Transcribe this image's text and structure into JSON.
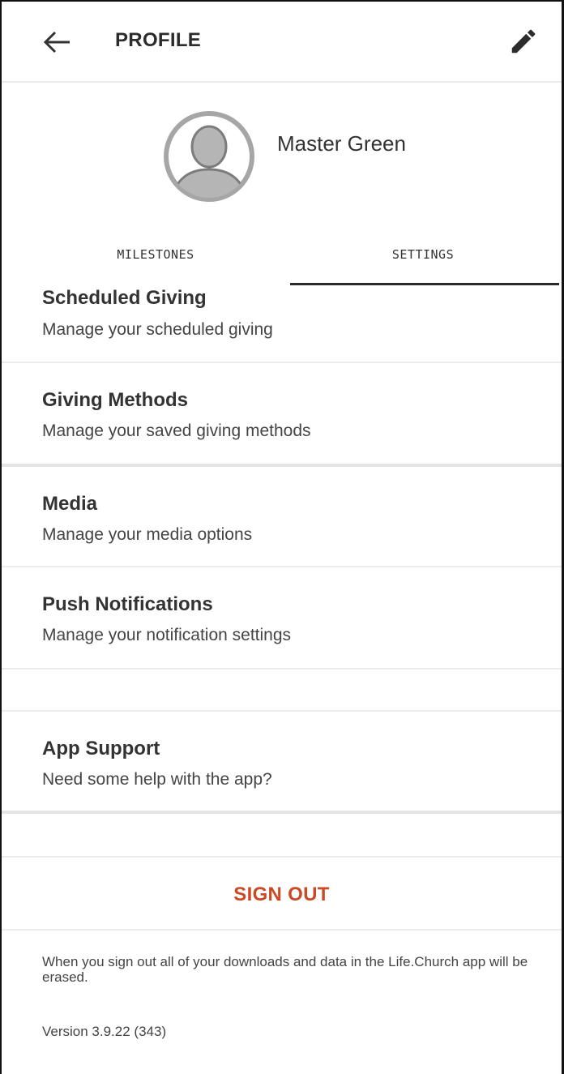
{
  "header": {
    "title": "PROFILE",
    "back_icon": "arrow-left-icon",
    "edit_icon": "pencil-icon"
  },
  "profile": {
    "name": "Master Green",
    "avatar_icon": "default-avatar-icon"
  },
  "tabs": [
    {
      "label": "MILESTONES",
      "selected": false
    },
    {
      "label": "SETTINGS",
      "selected": true
    }
  ],
  "settings": [
    {
      "title": "Scheduled Giving",
      "subtitle": "Manage your scheduled giving"
    },
    {
      "title": "Giving Methods",
      "subtitle": "Manage your saved giving methods"
    },
    {
      "title": "Media",
      "subtitle": "Manage your media options"
    },
    {
      "title": "Push Notifications",
      "subtitle": "Manage your notification settings"
    }
  ],
  "support": {
    "title": "App Support",
    "subtitle": "Need some help with the app?"
  },
  "sign_out": {
    "label": "SIGN OUT",
    "color": "#c94a25"
  },
  "footer": {
    "notice": "When you sign out all of your downloads and data in the Life.Church app will be erased.",
    "version": "Version 3.9.22 (343)"
  }
}
